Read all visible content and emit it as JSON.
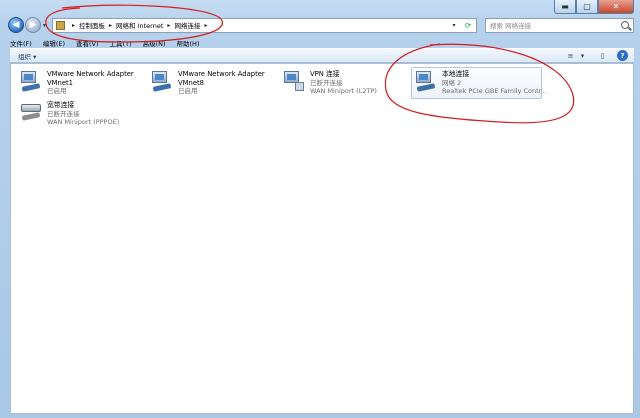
{
  "caption": {
    "minimize": "▬",
    "maximize": "▢",
    "close": "✕"
  },
  "nav": {
    "back": "◀",
    "forward": "▶",
    "dropdown": "▾"
  },
  "address": {
    "crumbs": [
      "控制面板",
      "网络和 Internet",
      "网络连接"
    ],
    "separator": "▸",
    "dropdown": "▾",
    "refresh": "⟳"
  },
  "search": {
    "placeholder": "搜索 网络连接"
  },
  "menu": [
    "文件(F)",
    "编辑(E)",
    "查看(V)",
    "工具(T)",
    "高级(N)",
    "帮助(H)"
  ],
  "toolbar": {
    "organize": "组织 ▾",
    "view_icon": "≡",
    "view_drop": "▾",
    "pane_icon": "▯",
    "help_icon": "?"
  },
  "connections": [
    {
      "name": "VMware Network Adapter",
      "line2": "VMnet1",
      "line3": "已启用",
      "kind": "lan"
    },
    {
      "name": "VMware Network Adapter",
      "line2": "VMnet8",
      "line3": "已启用",
      "kind": "lan"
    },
    {
      "name": "VPN 连接",
      "line2": "已断开连接",
      "line3": "WAN Miniport (L2TP)",
      "kind": "vpn"
    },
    {
      "name": "本地连接",
      "line2": "网络 2",
      "line3": "Realtek PCIe GBE Family Contr...",
      "kind": "lan",
      "selected": true
    },
    {
      "name": "宽带连接",
      "line2": "已断开连接",
      "line3": "WAN Miniport (PPPOE)",
      "kind": "dial"
    }
  ],
  "colors": {
    "annotation": "#d21f1f",
    "accent": "#2a6fc1"
  }
}
